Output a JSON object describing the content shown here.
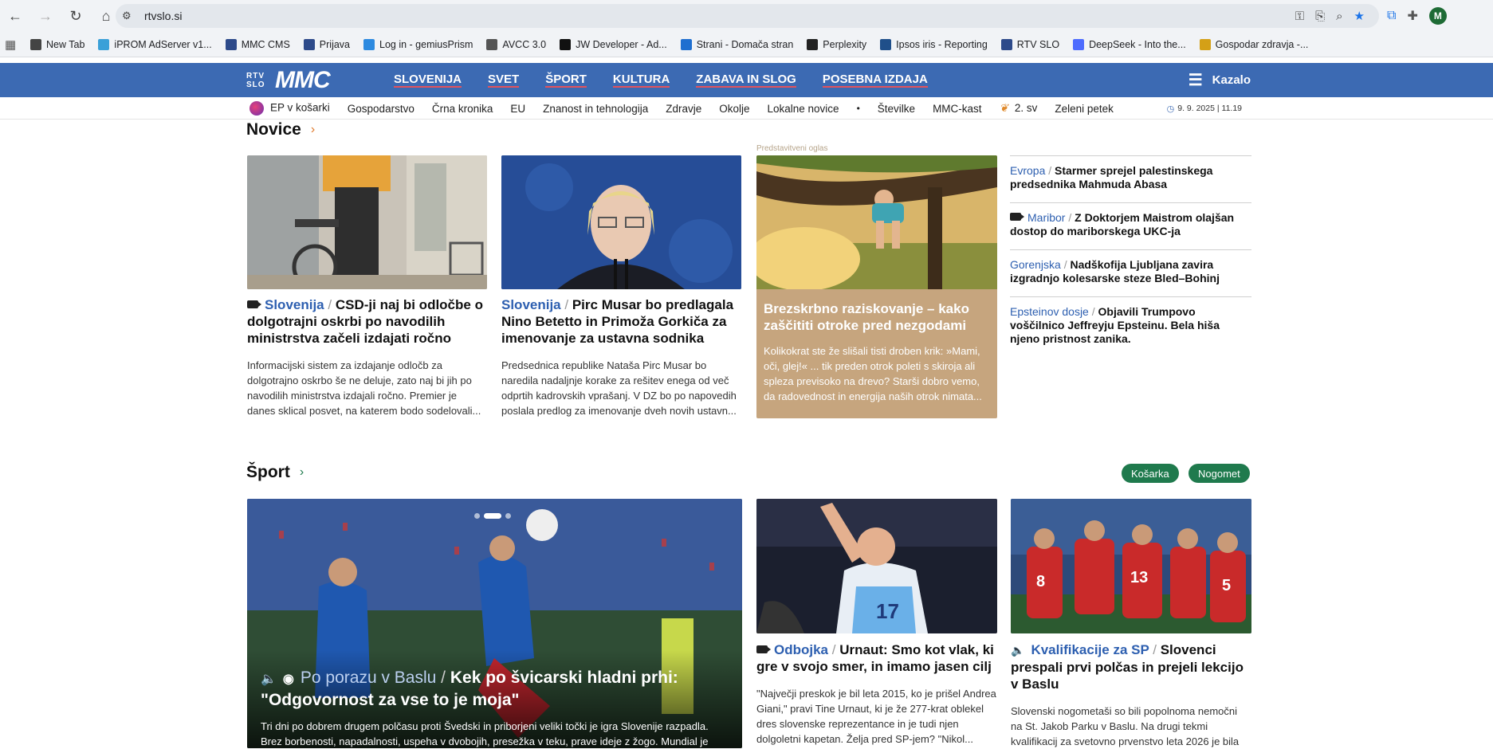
{
  "browser": {
    "url": "rtvslo.si",
    "bookmarks": [
      {
        "label": "New Tab",
        "color": "#444"
      },
      {
        "label": "iPROM AdServer v1...",
        "color": "#3aa0d8"
      },
      {
        "label": "MMC CMS",
        "color": "#2d4a8a"
      },
      {
        "label": "Prijava",
        "color": "#2d4a8a"
      },
      {
        "label": "Log in - gemiusPrism",
        "color": "#2d8ae0"
      },
      {
        "label": "AVCC 3.0",
        "color": "#555"
      },
      {
        "label": "JW Developer - Ad...",
        "color": "#111"
      },
      {
        "label": "Strani - Domača stran",
        "color": "#1f6fd0"
      },
      {
        "label": "Perplexity",
        "color": "#222"
      },
      {
        "label": "Ipsos iris - Reporting",
        "color": "#1f4f8a"
      },
      {
        "label": "RTV SLO",
        "color": "#2d4a8a"
      },
      {
        "label": "DeepSeek - Into the...",
        "color": "#4d6bfe"
      },
      {
        "label": "Gospodar zdravja -...",
        "color": "#d4a017"
      }
    ],
    "avatar_letter": "M"
  },
  "site": {
    "logo_rtv": "RTV SLO",
    "logo_mmc": "MMC",
    "menu": [
      "SLOVENIJA",
      "SVET",
      "ŠPORT",
      "KULTURA",
      "ZABAVA IN SLOG",
      "POSEBNA IZDAJA"
    ],
    "kazalo": "Kazalo",
    "sub_menu": {
      "ep": "EP v košarki",
      "items": [
        "Gospodarstvo",
        "Črna kronika",
        "EU",
        "Znanost in tehnologija",
        "Zdravje",
        "Okolje",
        "Lokalne novice"
      ],
      "dot": "•",
      "items2": [
        "Številke",
        "MMC-kast"
      ],
      "week": "2. sv",
      "green": "Zeleni petek"
    },
    "datetime": "9. 9. 2025 | 11.19"
  },
  "novice": {
    "title": "Novice",
    "cards": [
      {
        "cat": "Slovenija",
        "title": "CSD-ji naj bi odločbe o dolgotrajni oskrbi po navodilih ministrstva začeli izdajati ročno",
        "lead": "Informacijski sistem za izdajanje odločb za dolgotrajno oskrbo še ne deluje, zato naj bi jih po navodilih ministrstva izdajali ročno. Premier je danes sklical posvet, na katerem bodo sodelovali..."
      },
      {
        "cat": "Slovenija",
        "title": "Pirc Musar bo predlagala Nino Betetto in Primoža Gorkiča za imenovanje za ustavna sodnika",
        "lead": "Predsednica republike Nataša Pirc Musar bo naredila nadaljnje korake za rešitev enega od več odprtih kadrovskih vprašanj. V DZ bo po napovedih poslala predlog za imenovanje dveh novih ustavn..."
      }
    ],
    "ad": {
      "label": "Predstavitveni oglas",
      "title": "Brezskrbno raziskovanje – kako zaščititi otroke pred nezgodami",
      "lead": "Kolikokrat ste že slišali tisti droben krik: »Mami, oči, glej!« ... tik preden otrok poleti s skiroja ali spleza previsoko na drevo? Starši dobro vemo, da radovednost in energija naših otrok nimata..."
    },
    "side": [
      {
        "cat": "Evropa",
        "title": "Starmer sprejel palestinskega predsednika Mahmuda Abasa"
      },
      {
        "cat": "Maribor",
        "title": "Z Doktorjem Maistrom olajšan dostop do mariborskega UKC-ja"
      },
      {
        "cat": "Gorenjska",
        "title": "Nadškofija Ljubljana zavira izgradnjo kolesarske steze Bled–Bohinj"
      },
      {
        "cat": "Epsteinov dosje",
        "title": "Objavili Trumpovo voščilnico Jeffreyju Epsteinu. Bela hiša njeno pristnost zanika."
      }
    ]
  },
  "sport": {
    "title": "Šport",
    "pills": [
      "Košarka",
      "Nogomet"
    ],
    "hero": {
      "cat": "Po porazu v Baslu",
      "title": "Kek po švicarski hladni prhi: \"Odgovornost za vse to je moja\"",
      "lead": "Tri dni po dobrem drugem polčasu proti Švedski in priborjeni veliki točki je igra Slovenije razpadla. Brez borbenosti, napadalnosti, uspeha v dvobojih, presežka v teku, prave ideje z žogo. Mundial je"
    },
    "cards": [
      {
        "cat": "Odbojka",
        "title": "Urnaut: Smo kot vlak, ki gre v svojo smer, in imamo jasen cilj",
        "lead": "\"Največji preskok je bil leta 2015, ko je prišel Andrea Giani,\" pravi Tine Urnaut, ki je že 277-krat oblekel dres slovenske reprezentance in je tudi njen dolgoletni kapetan. Želja pred SP-jem? \"Nikol..."
      },
      {
        "cat": "Kvalifikacije za SP",
        "title": "Slovenci prespali prvi polčas in prejeli lekcijo v Baslu",
        "lead": "Slovenski nogometaši so bili popolnoma nemočni na St. Jakob Parku v Baslu. Na drugi tekmi kvalifikacij za svetovno prvenstvo leta 2026 je bila"
      }
    ]
  }
}
